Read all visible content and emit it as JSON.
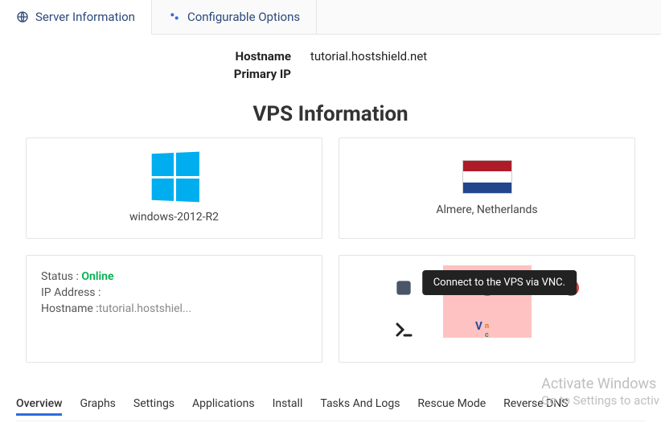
{
  "topTabs": {
    "serverInfo": "Server Information",
    "configOptions": "Configurable Options"
  },
  "info": {
    "hostnameLabel": "Hostname",
    "hostnameValue": "tutorial.hostshield.net",
    "primaryIpLabel": "Primary IP",
    "primaryIpValue": ""
  },
  "sectionTitle": "VPS Information",
  "osCard": {
    "caption": "windows-2012-R2"
  },
  "locationCard": {
    "caption": "Almere, Netherlands"
  },
  "statusCard": {
    "statusLabel": "Status :",
    "statusValue": "Online",
    "ipLabel": "IP Address :",
    "ipValue": "",
    "hostnameLabel": "Hostname :",
    "hostnameValue": "tutorial.hostshiel..."
  },
  "tooltip": "Connect to the VPS via VNC.",
  "bottomTabs": {
    "overview": "Overview",
    "graphs": "Graphs",
    "settings": "Settings",
    "applications": "Applications",
    "install": "Install",
    "tasks": "Tasks And Logs",
    "rescue": "Rescue Mode",
    "rdns": "Reverse DNS"
  },
  "watermark": {
    "l1": "Activate Windows",
    "l2": "Go to Settings to activ"
  }
}
